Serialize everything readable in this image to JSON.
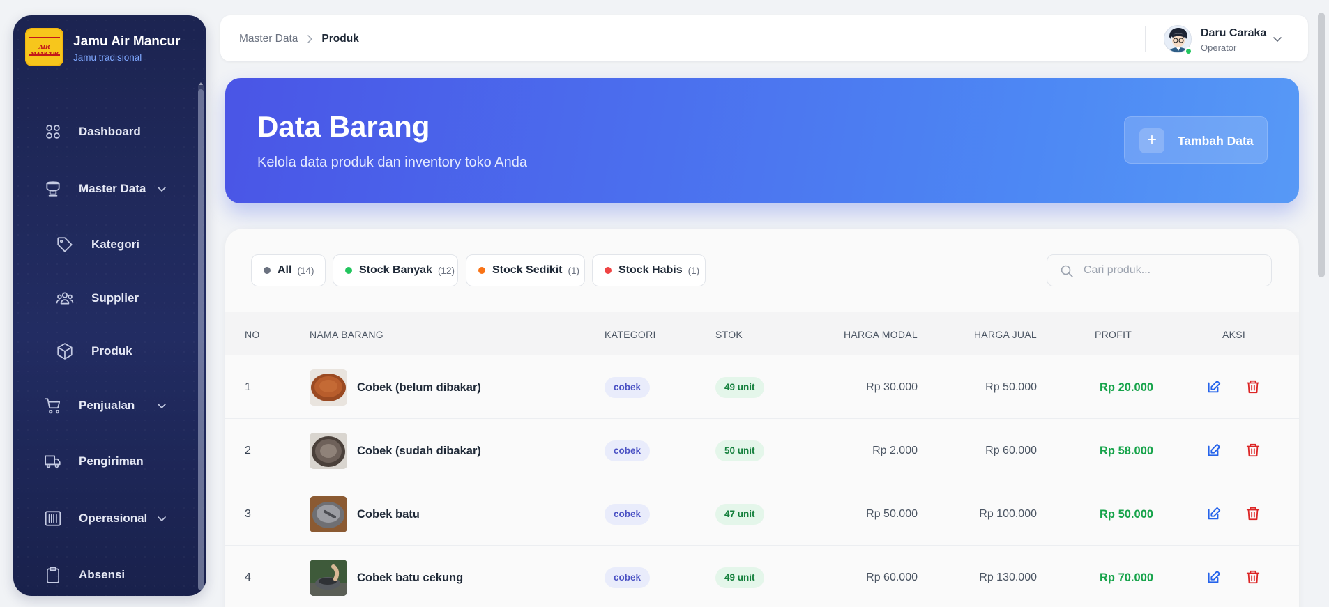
{
  "brand": {
    "title": "Jamu Air Mancur",
    "subtitle": "Jamu tradisional",
    "logo_text": "AIR MANCUR"
  },
  "sidebar": {
    "items": [
      {
        "label": "Dashboard",
        "icon": "grid-icon"
      },
      {
        "label": "Master Data",
        "icon": "database-icon",
        "expanded": true
      },
      {
        "label": "Kategori",
        "icon": "tag-icon"
      },
      {
        "label": "Supplier",
        "icon": "users-icon"
      },
      {
        "label": "Produk",
        "icon": "box-icon"
      },
      {
        "label": "Penjualan",
        "icon": "cart-icon"
      },
      {
        "label": "Pengiriman",
        "icon": "truck-icon"
      },
      {
        "label": "Operasional",
        "icon": "barcode-icon"
      },
      {
        "label": "Absensi",
        "icon": "clipboard-icon"
      }
    ]
  },
  "topbar": {
    "breadcrumb": [
      "Master Data",
      "Produk"
    ],
    "user": {
      "name": "Daru Caraka",
      "role": "Operator",
      "status": "online"
    }
  },
  "hero": {
    "title": "Data Barang",
    "subtitle": "Kelola data produk dan inventory toko Anda",
    "add_button": "Tambah Data"
  },
  "filters": [
    {
      "label": "All",
      "count": "(14)",
      "color": "#6b7280"
    },
    {
      "label": "Stock Banyak",
      "count": "(12)",
      "color": "#22c55e"
    },
    {
      "label": "Stock Sedikit",
      "count": "(1)",
      "color": "#f97316"
    },
    {
      "label": "Stock Habis",
      "count": "(1)",
      "color": "#ef4444"
    }
  ],
  "search": {
    "placeholder": "Cari produk..."
  },
  "table": {
    "columns": [
      "NO",
      "NAMA BARANG",
      "KATEGORI",
      "STOK",
      "HARGA MODAL",
      "HARGA JUAL",
      "PROFIT",
      "AKSI"
    ],
    "rows": [
      {
        "no": "1",
        "name": "Cobek (belum dibakar)",
        "category": "cobek",
        "stock": "49 unit",
        "cost": "Rp 30.000",
        "price": "Rp 50.000",
        "profit": "Rp 20.000"
      },
      {
        "no": "2",
        "name": "Cobek (sudah dibakar)",
        "category": "cobek",
        "stock": "50 unit",
        "cost": "Rp 2.000",
        "price": "Rp 60.000",
        "profit": "Rp 58.000"
      },
      {
        "no": "3",
        "name": "Cobek batu",
        "category": "cobek",
        "stock": "47 unit",
        "cost": "Rp 50.000",
        "price": "Rp 100.000",
        "profit": "Rp 50.000"
      },
      {
        "no": "4",
        "name": "Cobek batu cekung",
        "category": "cobek",
        "stock": "49 unit",
        "cost": "Rp 60.000",
        "price": "Rp 130.000",
        "profit": "Rp 70.000"
      }
    ]
  },
  "colors": {
    "accent": "#4b6fee",
    "sidebar": "#1c2451",
    "profit": "#16a34a",
    "edit": "#2563eb",
    "delete": "#dc2626"
  }
}
